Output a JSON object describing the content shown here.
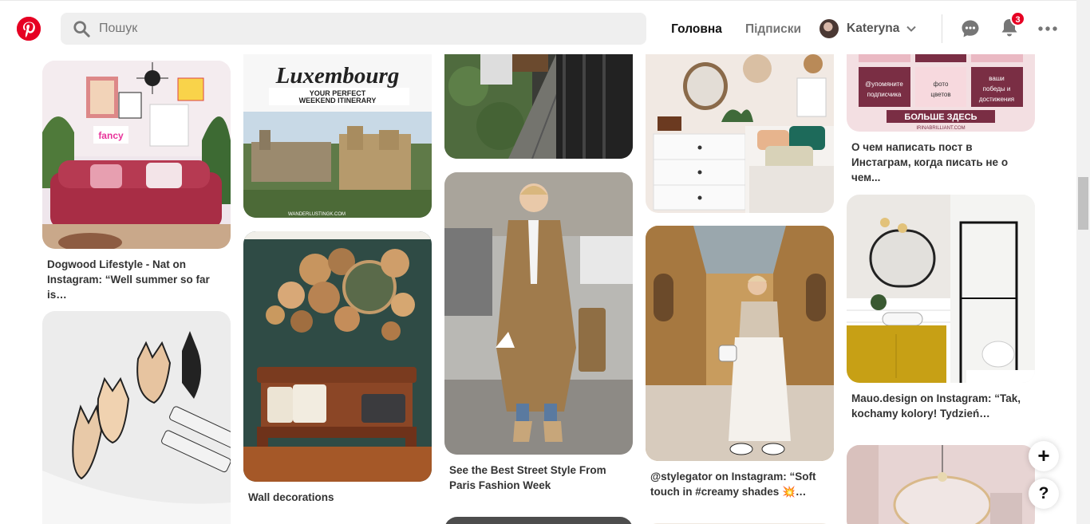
{
  "header": {
    "search_placeholder": "Пошук",
    "nav_home": "Головна",
    "nav_following": "Підписки",
    "user_name": "Kateryna",
    "notification_count": "3"
  },
  "pins": [
    {
      "caption": "Dogwood Lifestyle - Nat on Instagram: “Well summer so far is…",
      "image": "pink-sofa-living-room-photo"
    },
    {
      "caption": "",
      "image": "lingerie-sketch-photo"
    },
    {
      "caption": "",
      "image": "luxembourg-travel-photo",
      "overlay_title": "Luxembourg",
      "overlay_subtitle": "YOUR PERFECT WEEKEND ITINERARY",
      "credit": "WANDERLUSTINGK.COM"
    },
    {
      "caption": "Wall decorations",
      "image": "woven-baskets-wall-photo"
    },
    {
      "caption": "",
      "image": "balcony-plants-photo"
    },
    {
      "caption": "See the Best Street Style From Paris Fashion Week",
      "image": "trench-coat-street-style-photo"
    },
    {
      "caption": "",
      "image": "bedroom-decor-photo"
    },
    {
      "caption": "@stylegator on Instagram: “Soft touch in #creamy shades 💥…",
      "image": "galleria-fashion-photo"
    },
    {
      "caption": "О чем написать пост в Инстаграм, когда писать не о чем...",
      "image": "instagram-tips-graphic",
      "tiles": [
        "@упомяните подписчика",
        "фото цветов",
        "ваши победы и достижения"
      ],
      "banner": "БОЛЬШЕ ЗДЕСЬ",
      "credit": "IRINABRILLIANT.COM"
    },
    {
      "caption": "Mauo.design on Instagram: “Tak, kochamy kolory! Tydzień…",
      "image": "yellow-bathroom-photo"
    },
    {
      "caption": "",
      "image": "pink-bathroom-photo"
    }
  ],
  "colors": {
    "brand": "#e60023"
  },
  "fab": {
    "add": "+",
    "help": "?"
  }
}
